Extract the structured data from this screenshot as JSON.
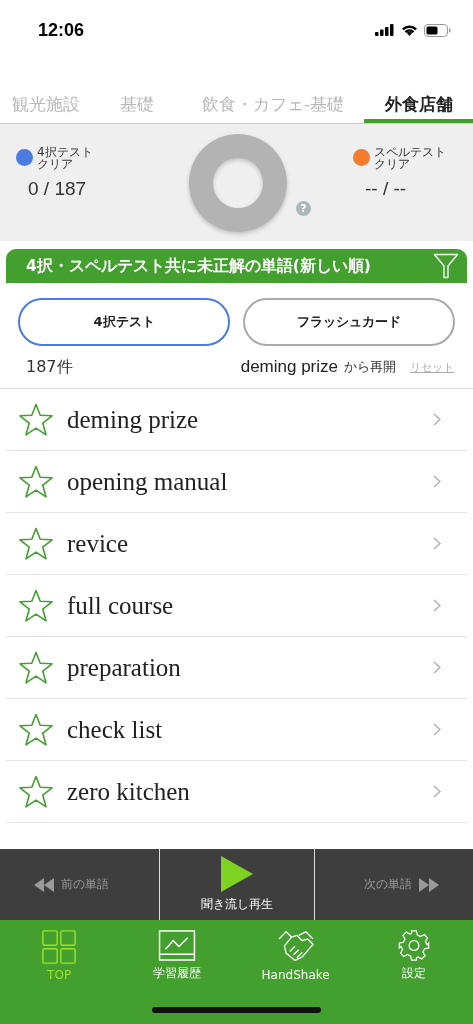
{
  "status_bar": {
    "time": "12:06"
  },
  "tabs": [
    {
      "label": "観光施設",
      "selected": false
    },
    {
      "label": "基礎",
      "selected": false
    },
    {
      "label": "飲食・カフェ-基礎",
      "selected": false
    },
    {
      "label": "外食店舗",
      "selected": true
    }
  ],
  "stats": {
    "left": {
      "label": "4択テストクリア",
      "value": "0 / 187",
      "color": "#4a7be0"
    },
    "right": {
      "label": "スペルテストクリア",
      "value": "-- / --",
      "color": "#f47c2a"
    },
    "help": "?"
  },
  "filter_header": {
    "title": "4択・スペルテスト共に未正解の単語(新しい順)"
  },
  "mode_buttons": [
    {
      "label": "4択テスト",
      "selected": true
    },
    {
      "label": "フラッシュカード",
      "selected": false
    }
  ],
  "resume": {
    "count": "187件",
    "word": "deming prize",
    "suffix": "から再開",
    "reset": "リセット"
  },
  "words": [
    {
      "text": "deming prize",
      "starred": false
    },
    {
      "text": "opening manual",
      "starred": false
    },
    {
      "text": "revice",
      "starred": false
    },
    {
      "text": "full course",
      "starred": false
    },
    {
      "text": "preparation",
      "starred": false
    },
    {
      "text": "check list",
      "starred": false
    },
    {
      "text": "zero kitchen",
      "starred": false
    }
  ],
  "player": {
    "prev": "前の単語",
    "play": "聞き流し再生",
    "next": "次の単語"
  },
  "bottom_nav": [
    {
      "label": "TOP",
      "kind": "grid",
      "selected": true
    },
    {
      "label": "学習履歴",
      "kind": "chart",
      "selected": false
    },
    {
      "label": "HandShake",
      "kind": "handshake",
      "selected": false
    },
    {
      "label": "設定",
      "kind": "gear",
      "selected": false
    }
  ]
}
